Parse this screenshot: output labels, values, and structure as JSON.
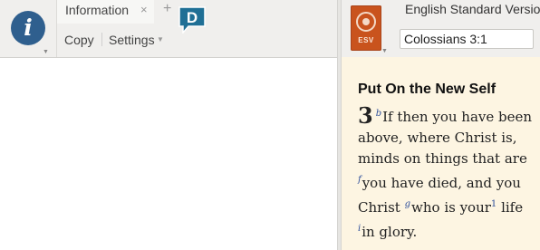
{
  "left_panel": {
    "info_icon_glyph": "i",
    "tab": {
      "label": "Information",
      "close": "×"
    },
    "add_tab": "+",
    "toolbar": {
      "copy": "Copy",
      "settings": "Settings"
    },
    "logo_letter": "D"
  },
  "right_panel": {
    "resource_title": "English Standard Version",
    "reference": "Colossians 3:1",
    "cover_text": "ESV",
    "heading": "Put On the New Self",
    "chapter": "3",
    "lines": [
      {
        "note": "b",
        "text": "If then you have been"
      },
      {
        "text": "above, where Christ is, "
      },
      {
        "text": "minds on things that are"
      },
      {
        "note": "f",
        "text": "you have died, and you"
      },
      {
        "text_a": "Christ ",
        "note": "g",
        "text_b": "who is your",
        "note2": "1",
        "text_c": " life"
      },
      {
        "note": "i",
        "text": "in glory."
      }
    ]
  },
  "colors": {
    "accent_blue": "#2f5f8e",
    "esv_orange": "#c9531d",
    "footnote_blue": "#2d4e9b",
    "page_bg": "#fdf5e2"
  }
}
